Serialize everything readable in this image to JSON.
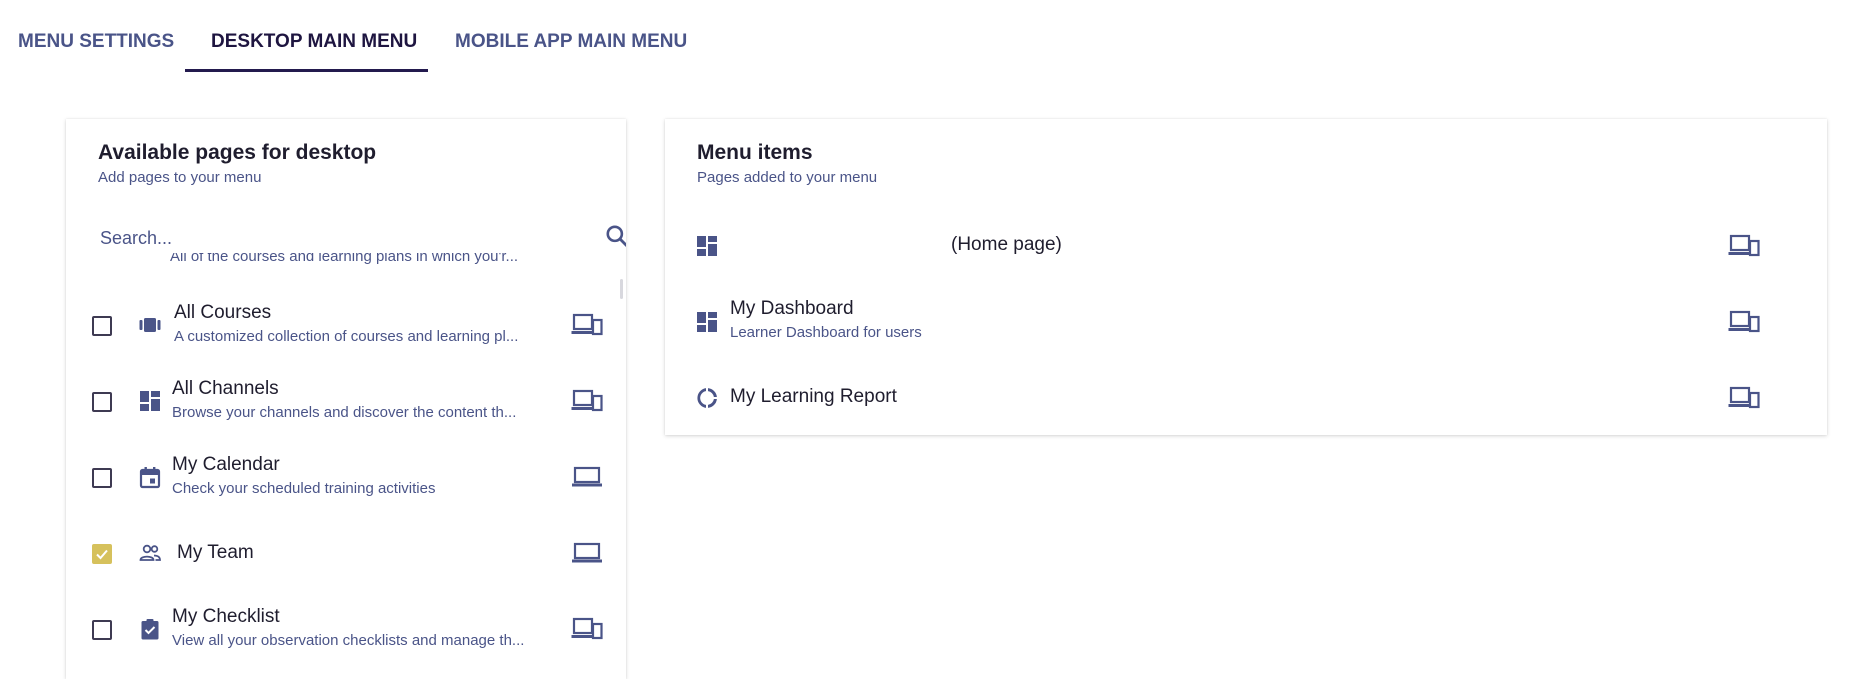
{
  "tabs": [
    {
      "label": "MENU SETTINGS",
      "active": false
    },
    {
      "label": "DESKTOP MAIN MENU",
      "active": true
    },
    {
      "label": "MOBILE APP MAIN MENU",
      "active": false
    }
  ],
  "colors": {
    "accent": "#4a5488",
    "active_tab": "#231a4e",
    "checked": "#d6c15c"
  },
  "available": {
    "title": "Available pages for desktop",
    "subtitle": "Add pages to your menu",
    "search_placeholder": "Search...",
    "clipped_description": "All of the courses and learning plans in which you'r...",
    "items": [
      {
        "title": "All Courses",
        "description": "A customized collection of courses and learning pl...",
        "icon": "courses-icon",
        "checked": false,
        "device": "desktop-mobile-icon"
      },
      {
        "title": "All Channels",
        "description": "Browse your channels and discover the content th...",
        "icon": "dashboard-icon",
        "checked": false,
        "device": "desktop-mobile-icon"
      },
      {
        "title": "My Calendar",
        "description": "Check your scheduled training activities",
        "icon": "calendar-icon",
        "checked": true,
        "device": "laptop-icon"
      },
      {
        "title": "My Team",
        "description": "",
        "icon": "team-icon",
        "checked": true,
        "device": "laptop-icon"
      },
      {
        "title": "My Checklist",
        "description": "View all your observation checklists and manage th...",
        "icon": "checklist-icon",
        "checked": false,
        "device": "desktop-mobile-icon"
      }
    ]
  },
  "menu": {
    "title": "Menu items",
    "subtitle": "Pages added to your menu",
    "items": [
      {
        "title": "",
        "home_label": "(Home page)",
        "description": "",
        "icon": "dashboard-icon",
        "device": "desktop-mobile-icon"
      },
      {
        "title": "My Dashboard",
        "description": "Learner Dashboard for users",
        "icon": "dashboard-icon",
        "device": "desktop-mobile-icon"
      },
      {
        "title": "My Learning Report",
        "description": "",
        "icon": "report-icon",
        "device": "desktop-mobile-icon"
      }
    ]
  }
}
